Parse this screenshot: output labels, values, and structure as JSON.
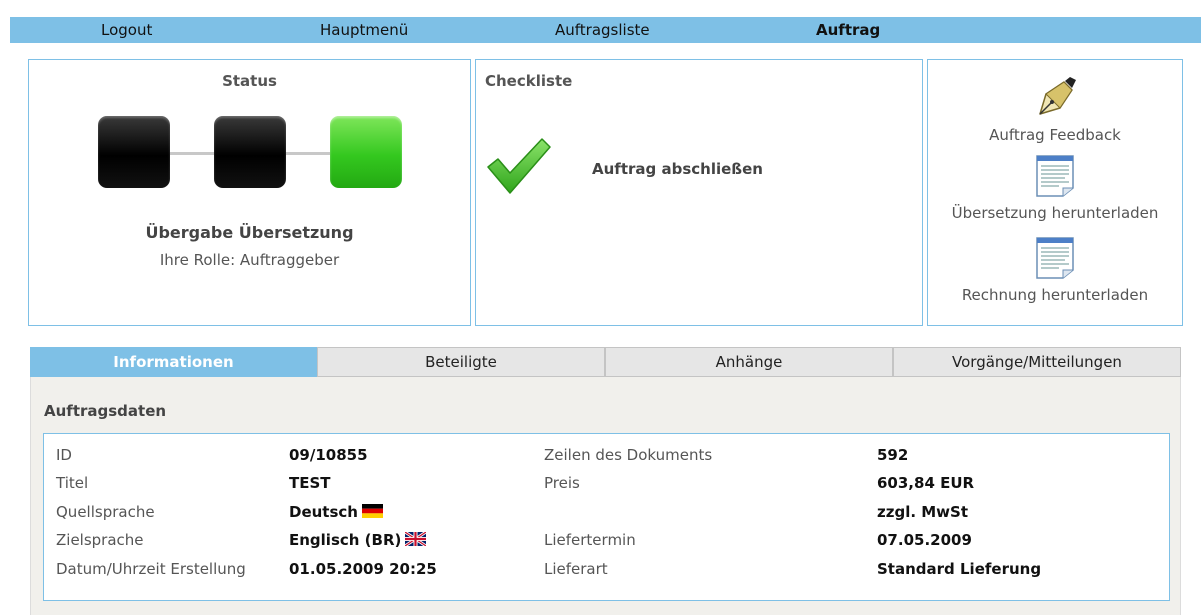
{
  "nav": {
    "items": [
      "Logout",
      "Hauptmenü",
      "Auftragsliste",
      "Auftrag"
    ],
    "active": "Auftrag",
    "color": "#7ec0e6"
  },
  "status": {
    "title": "Status",
    "steps": [
      {
        "state": "done",
        "color": "#000000"
      },
      {
        "state": "done",
        "color": "#000000"
      },
      {
        "state": "current",
        "color": "#34c81f"
      }
    ],
    "label": "Übergabe Übersetzung",
    "role": "Ihre Rolle: Auftraggeber"
  },
  "checklist": {
    "title": "Checkliste",
    "item_icon": "checkmark-icon",
    "item": "Auftrag abschließen"
  },
  "actions": [
    {
      "icon": "fountain-pen-icon",
      "label": "Auftrag Feedback"
    },
    {
      "icon": "document-icon",
      "label": "Übersetzung herunterladen"
    },
    {
      "icon": "document-icon",
      "label": "Rechnung herunterladen"
    }
  ],
  "tabs": [
    {
      "label": "Informationen",
      "active": true
    },
    {
      "label": "Beteiligte",
      "active": false
    },
    {
      "label": "Anhänge",
      "active": false
    },
    {
      "label": "Vorgänge/Mitteilungen",
      "active": false
    }
  ],
  "order": {
    "section_title": "Auftragsdaten",
    "left": [
      {
        "label": "ID",
        "value": "09/10855"
      },
      {
        "label": "Titel",
        "value": "TEST"
      },
      {
        "label": "Quellsprache",
        "value": "Deutsch",
        "flag": "de-flag-icon"
      },
      {
        "label": "Zielsprache",
        "value": "Englisch (BR)",
        "flag": "uk-flag-icon"
      },
      {
        "label": "Datum/Uhrzeit Erstellung",
        "value": "01.05.2009 20:25"
      }
    ],
    "right": [
      {
        "label": "Zeilen des Dokuments",
        "value": "592"
      },
      {
        "label": "Preis",
        "value": "603,84 EUR"
      },
      {
        "label": "",
        "value": "zzgl. MwSt"
      },
      {
        "label": "Liefertermin",
        "value": "07.05.2009"
      },
      {
        "label": "Lieferart",
        "value": "Standard Lieferung"
      }
    ]
  }
}
